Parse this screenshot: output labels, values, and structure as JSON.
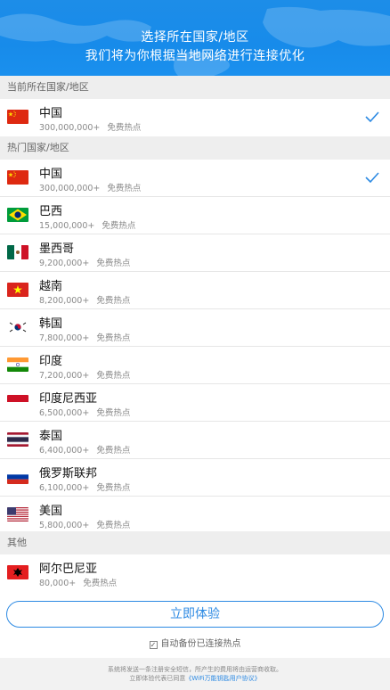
{
  "header": {
    "line1": "选择所在国家/地区",
    "line2": "我们将为你根据当地网络进行连接优化"
  },
  "sections": {
    "current": "当前所在国家/地区",
    "hot": "热门国家/地区",
    "other": "其他"
  },
  "free_label": "免费热点",
  "current_country": {
    "name": "中国",
    "count": "300,000,000+",
    "flag": "cn-flag",
    "selected": true
  },
  "hot_countries": [
    {
      "name": "中国",
      "count": "300,000,000+",
      "flag": "cn-flag",
      "selected": true
    },
    {
      "name": "巴西",
      "count": "15,000,000+",
      "flag": "br-flag",
      "selected": false
    },
    {
      "name": "墨西哥",
      "count": "9,200,000+",
      "flag": "mx-flag",
      "selected": false
    },
    {
      "name": "越南",
      "count": "8,200,000+",
      "flag": "vn-flag",
      "selected": false
    },
    {
      "name": "韩国",
      "count": "7,800,000+",
      "flag": "kr-flag",
      "selected": false
    },
    {
      "name": "印度",
      "count": "7,200,000+",
      "flag": "in-flag",
      "selected": false
    },
    {
      "name": "印度尼西亚",
      "count": "6,500,000+",
      "flag": "id-flag",
      "selected": false
    },
    {
      "name": "泰国",
      "count": "6,400,000+",
      "flag": "th-flag",
      "selected": false
    },
    {
      "name": "俄罗斯联邦",
      "count": "6,100,000+",
      "flag": "ru-flag",
      "selected": false
    },
    {
      "name": "美国",
      "count": "5,800,000+",
      "flag": "us-flag",
      "selected": false
    }
  ],
  "other_countries": [
    {
      "name": "阿尔巴尼亚",
      "count": "80,000+",
      "flag": "al-flag",
      "selected": false
    }
  ],
  "cta": {
    "label": "立即体验"
  },
  "backup": {
    "label": "自动备份已连接热点",
    "checked": true
  },
  "footer": {
    "line1": "系统将发送一条注册安全短信，所产生的费用将由运营商收取。",
    "line2_prefix": "立即体验代表已同意",
    "line2_link": "《WiFi万能钥匙用户协议》"
  },
  "colors": {
    "accent": "#2d8ae3",
    "header": "#178bea"
  }
}
